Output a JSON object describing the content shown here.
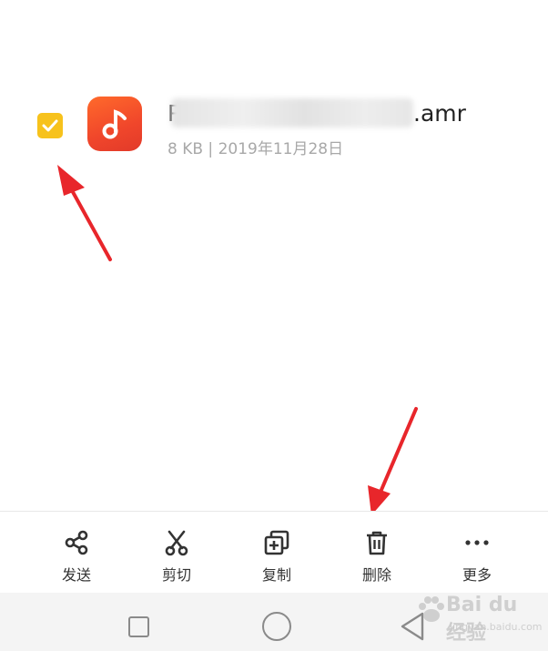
{
  "file": {
    "name_lead": "P",
    "extension": ".amr",
    "meta": "8 KB | 2019年11月28日",
    "selected": true,
    "icon": "music-note-icon"
  },
  "toolbar": {
    "items": [
      {
        "label": "发送",
        "icon": "share-icon"
      },
      {
        "label": "剪切",
        "icon": "scissors-icon"
      },
      {
        "label": "复制",
        "icon": "copy-icon"
      },
      {
        "label": "删除",
        "icon": "trash-icon"
      },
      {
        "label": "更多",
        "icon": "more-dots-icon"
      }
    ]
  },
  "navbar": {
    "buttons": [
      "recents-square-icon",
      "home-circle-icon",
      "back-triangle-icon"
    ]
  },
  "watermark": {
    "brand": "Bai du 经验",
    "sub": "jingyan.baidu.com"
  },
  "colors": {
    "checkbox": "#f7c21c",
    "music_icon": "#f0462b",
    "arrow": "#e8262b"
  }
}
